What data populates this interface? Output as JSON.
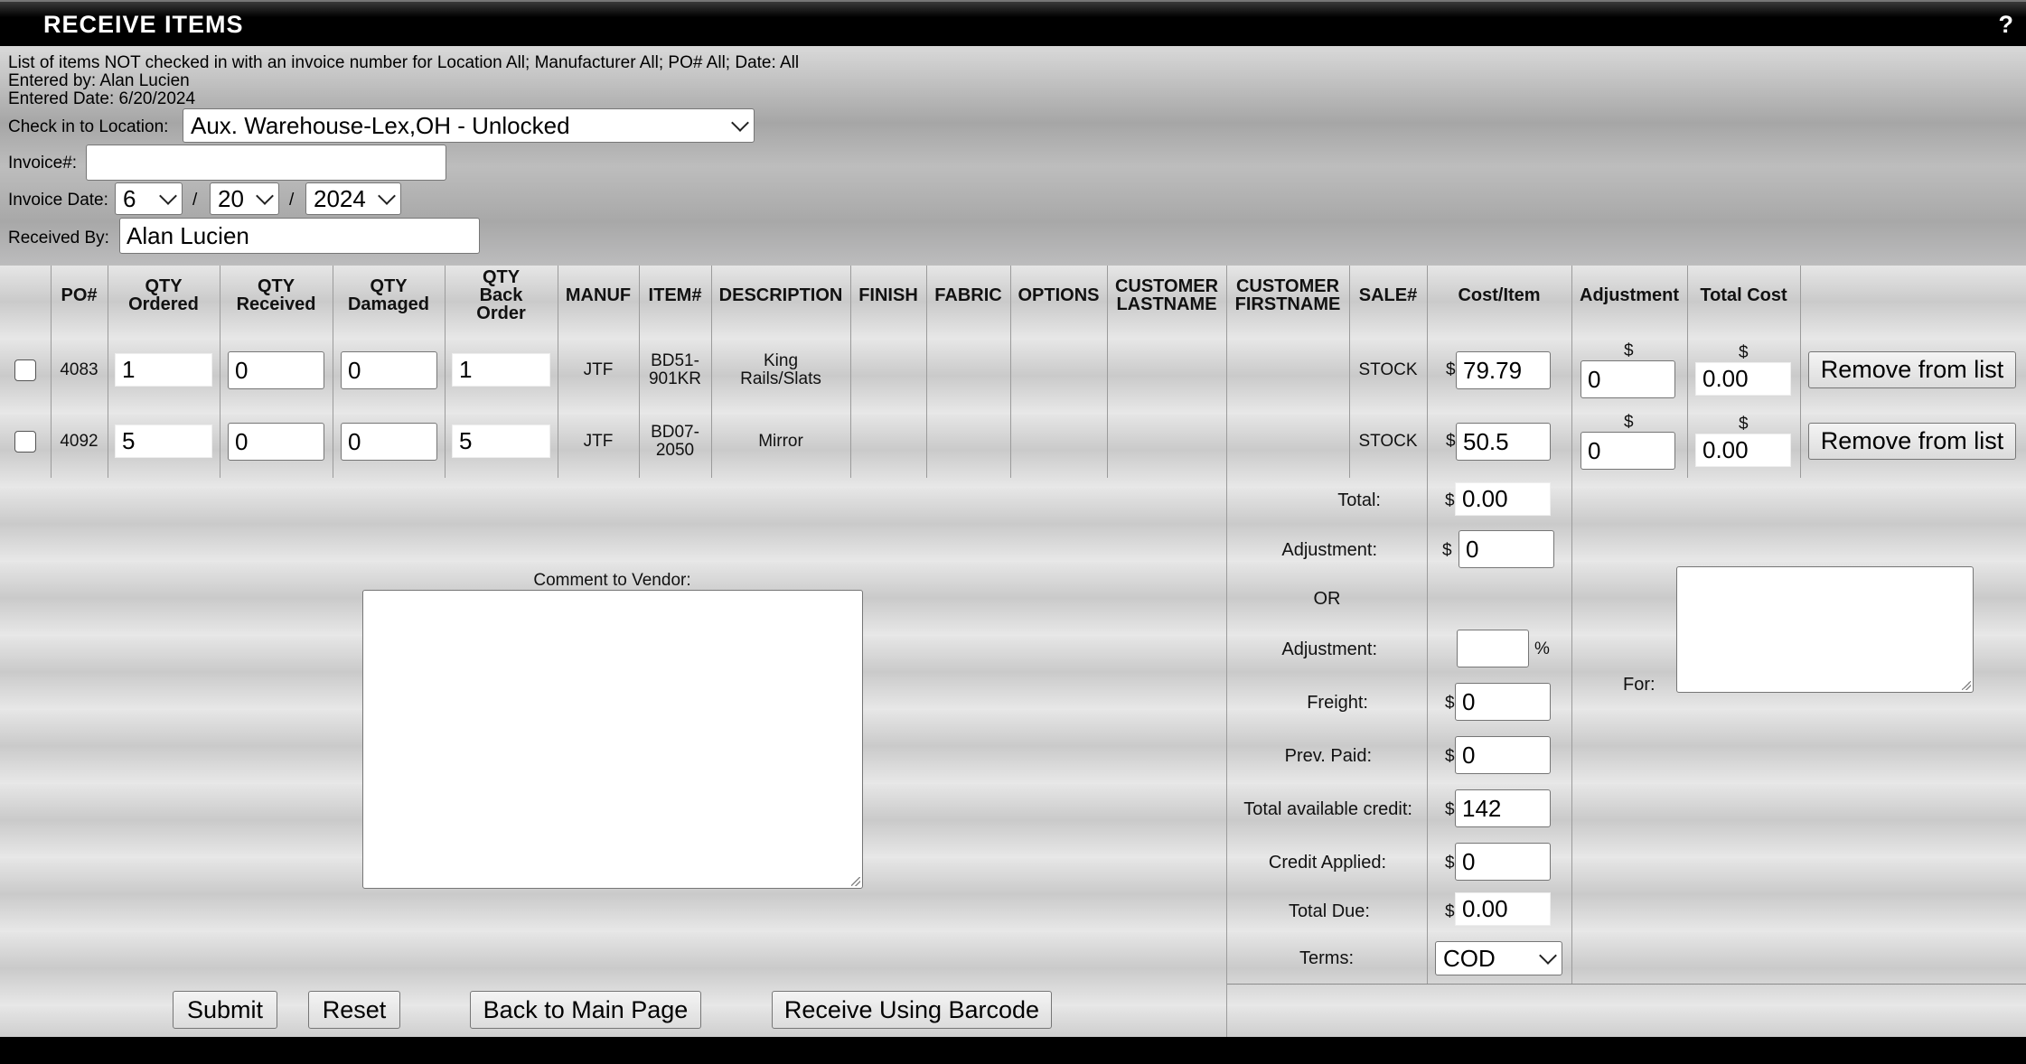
{
  "window": {
    "title": "RECEIVE ITEMS",
    "help": "?"
  },
  "info": {
    "list_desc": "List of items NOT checked in with an invoice number for Location All; Manufacturer All; PO# All; Date: All",
    "entered_by": "Entered by: Alan Lucien",
    "entered_date": "Entered Date: 6/20/2024"
  },
  "form": {
    "location_label": "Check in to Location:",
    "location_value": "Aux. Warehouse-Lex,OH - Unlocked",
    "invoice_label": "Invoice#:",
    "invoice_value": "",
    "invoice_date_label": "Invoice Date:",
    "month": "6",
    "day": "20",
    "year": "2024",
    "sep": "/",
    "received_by_label": "Received By:",
    "received_by_value": "Alan Lucien"
  },
  "columns": {
    "po": "PO#",
    "qty_ordered": [
      "QTY",
      "Ordered"
    ],
    "qty_received": [
      "QTY",
      "Received"
    ],
    "qty_damaged": [
      "QTY",
      "Damaged"
    ],
    "qty_back": [
      "QTY",
      "Back",
      "Order"
    ],
    "manuf": "MANUF",
    "item": "ITEM#",
    "description": "DESCRIPTION",
    "finish": "FINISH",
    "fabric": "FABRIC",
    "options": "OPTIONS",
    "cust_last": [
      "CUSTOMER",
      "LASTNAME"
    ],
    "cust_first": [
      "CUSTOMER",
      "FIRSTNAME"
    ],
    "sale": "SALE#",
    "cost": "Cost/Item",
    "adjustment": "Adjustment",
    "total_cost": "Total Cost"
  },
  "rows": [
    {
      "po": "4083",
      "ordered": "1",
      "received": "0",
      "damaged": "0",
      "back": "1",
      "manuf": "JTF",
      "item": [
        "BD51-",
        "901KR"
      ],
      "desc": [
        "King",
        "Rails/Slats"
      ],
      "sale": "STOCK",
      "cost": "79.79",
      "adj": "0",
      "total": "0.00",
      "remove": "Remove from list"
    },
    {
      "po": "4092",
      "ordered": "5",
      "received": "0",
      "damaged": "0",
      "back": "5",
      "manuf": "JTF",
      "item": [
        "BD07-",
        "2050"
      ],
      "desc": [
        "Mirror"
      ],
      "sale": "STOCK",
      "cost": "50.5",
      "adj": "0",
      "total": "0.00",
      "remove": "Remove from list"
    }
  ],
  "currency": "$",
  "summary": {
    "total_label": "Total:",
    "total_value": "0.00",
    "adj_label": "Adjustment:",
    "adj_value": "0",
    "or_label": "OR",
    "adj_pct_label": "Adjustment:",
    "adj_pct_value": "",
    "pct": "%",
    "freight_label": "Freight:",
    "freight_value": "0",
    "prev_paid_label": "Prev. Paid:",
    "prev_paid_value": "0",
    "credit_label": "Total available credit:",
    "credit_value": "142",
    "credit_applied_label": "Credit Applied:",
    "credit_applied_value": "0",
    "due_label": "Total Due:",
    "due_value": "0.00",
    "terms_label": "Terms:",
    "terms_value": "COD"
  },
  "comment_label": "Comment to Vendor:",
  "for_label": "For:",
  "buttons": {
    "submit": "Submit",
    "reset": "Reset",
    "back": "Back to Main Page",
    "barcode": "Receive Using Barcode"
  }
}
